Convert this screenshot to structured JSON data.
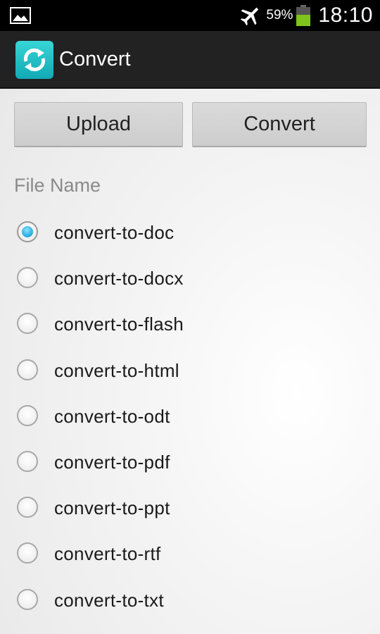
{
  "status_bar": {
    "battery_percent": "59%",
    "time": "18:10",
    "icons": [
      "gallery-icon",
      "airplane-mode-icon",
      "battery-icon"
    ],
    "battery_color": "#7fc41a"
  },
  "action_bar": {
    "title": "Convert",
    "app_icon": "refresh-arrows-icon",
    "app_icon_color": "#1fb8c4"
  },
  "buttons": {
    "upload_label": "Upload",
    "convert_label": "Convert"
  },
  "file_section": {
    "label": "File Name",
    "selected": "convert-to-doc",
    "options": [
      {
        "label": "convert-to-doc",
        "checked": true
      },
      {
        "label": "convert-to-docx",
        "checked": false
      },
      {
        "label": "convert-to-flash",
        "checked": false
      },
      {
        "label": "convert-to-html",
        "checked": false
      },
      {
        "label": "convert-to-odt",
        "checked": false
      },
      {
        "label": "convert-to-pdf",
        "checked": false
      },
      {
        "label": "convert-to-ppt",
        "checked": false
      },
      {
        "label": "convert-to-rtf",
        "checked": false
      },
      {
        "label": "convert-to-txt",
        "checked": false
      }
    ]
  },
  "colors": {
    "accent": "#33b5e5",
    "action_bar_bg": "#222222"
  }
}
